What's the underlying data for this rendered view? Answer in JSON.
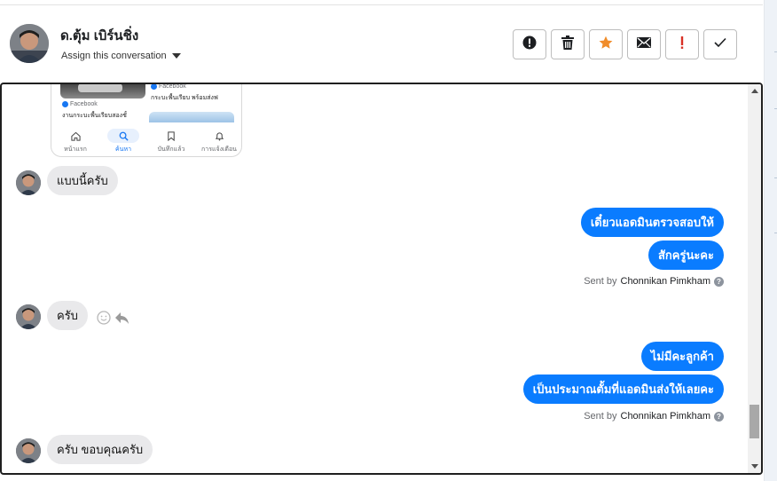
{
  "header": {
    "contact_name": "ด.ตุ้ม เบิร์นชิ่ง",
    "assign_label": "Assign this conversation",
    "actions": [
      {
        "name": "report-spam",
        "icon": "alert-circle-icon"
      },
      {
        "name": "delete",
        "icon": "trash-icon"
      },
      {
        "name": "star",
        "icon": "star-icon",
        "color": "#f08c2a"
      },
      {
        "name": "email",
        "icon": "envelope-icon"
      },
      {
        "name": "mark-important",
        "icon": "exclamation-icon",
        "color": "#d93025"
      },
      {
        "name": "mark-done",
        "icon": "check-icon"
      }
    ]
  },
  "embedded_screenshot": {
    "source_left": "Facebook",
    "caption_left": "งานกระบะพื้นเรียบสองชั้",
    "source_right": "Facebook",
    "caption_right": "กระบะพื้นเรียบ พร้อมส่งฟ",
    "nav": [
      {
        "label": "หน้าแรก",
        "icon": "home-icon"
      },
      {
        "label": "ค้นหา",
        "icon": "search-icon"
      },
      {
        "label": "บันทึกแล้ว",
        "icon": "bookmark-icon"
      },
      {
        "label": "การแจ้งเตือน",
        "icon": "bell-icon"
      }
    ]
  },
  "messages": {
    "in1": "แบบนี้ครับ",
    "out1": "เดี๋ยวแอดมินตรวจสอบให้",
    "out2": "สักครู่นะคะ",
    "sent1_prefix": "Sent by",
    "sent1_name": "Chonnikan Pimkham",
    "in2": "ครับ",
    "out3": "ไม่มีคะลูกค้า",
    "out4": "เป็นประมาณตั้มที่แอดมินส่งให้เลยคะ",
    "sent2_prefix": "Sent by",
    "sent2_name": "Chonnikan Pimkham",
    "in3": "ครับ ขอบคุณครับ"
  },
  "colors": {
    "outgoing_bubble": "#0a7cff",
    "incoming_bubble": "#e9e9eb"
  }
}
